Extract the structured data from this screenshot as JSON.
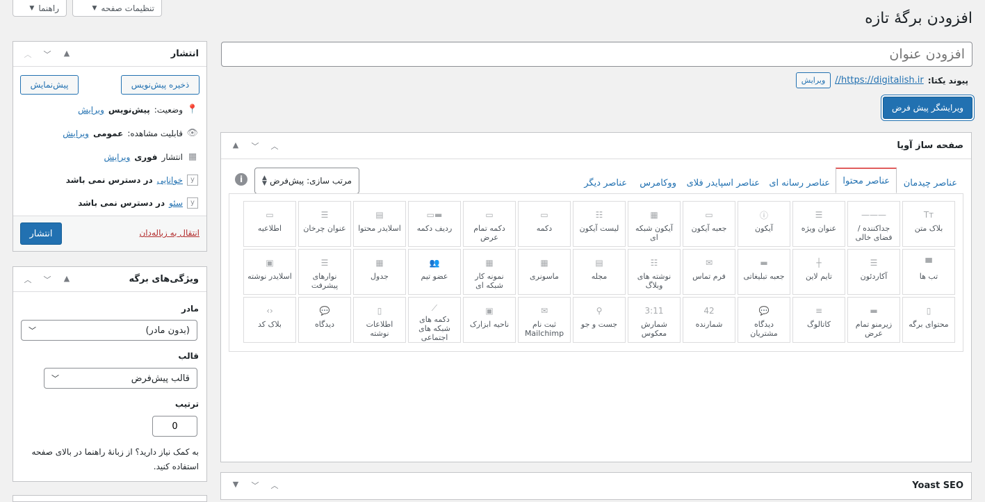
{
  "top_buttons": {
    "screen_options": "تنظیمات صفحه",
    "help": "راهنما"
  },
  "page_title": "افزودن برگهٔ تازه",
  "title_input": {
    "placeholder": "افزودن عنوان",
    "value": ""
  },
  "permalink": {
    "label": "پیوند یکتا:",
    "url": "https://digitalish.ir//",
    "edit": "ویرایش"
  },
  "default_editor_button": "ویرایشگر پیش فرض",
  "builder": {
    "title": "صفحه ساز آویا",
    "tabs": [
      "عناصر چیدمان",
      "عناصر محتوا",
      "عناصر رسانه ای",
      "عناصر اسپایدر فلای",
      "ووکامرس",
      "عناصر دیگر"
    ],
    "active_tab": "عناصر محتوا",
    "sort_label": "مرتب سازی: پیش‌فرض",
    "elements": [
      {
        "label": "بلاک متن",
        "icon": "text-block-icon"
      },
      {
        "label": "جداکننده / فضای خالی",
        "icon": "separator-icon"
      },
      {
        "label": "عنوان ویژه",
        "icon": "special-heading-icon"
      },
      {
        "label": "آیکون",
        "icon": "info-circle-icon"
      },
      {
        "label": "جعبه آیکون",
        "icon": "icon-box-icon"
      },
      {
        "label": "آیکون شبکه ای",
        "icon": "icon-grid-icon"
      },
      {
        "label": "لیست آیکون",
        "icon": "icon-list-icon"
      },
      {
        "label": "دکمه",
        "icon": "button-icon"
      },
      {
        "label": "دکمه تمام عرض",
        "icon": "fullwidth-button-icon"
      },
      {
        "label": "ردیف دکمه",
        "icon": "button-row-icon"
      },
      {
        "label": "اسلایدر محتوا",
        "icon": "content-slider-icon"
      },
      {
        "label": "عنوان چرخان",
        "icon": "rotating-heading-icon"
      },
      {
        "label": "اطلاعیه",
        "icon": "notification-icon"
      },
      {
        "label": "تب ها",
        "icon": "tabs-icon"
      },
      {
        "label": "آکاردئون",
        "icon": "accordion-icon"
      },
      {
        "label": "تایم لاین",
        "icon": "timeline-icon"
      },
      {
        "label": "جعبه تبلیغاتی",
        "icon": "promo-box-icon"
      },
      {
        "label": "فرم تماس",
        "icon": "envelope-icon"
      },
      {
        "label": "نوشته های وبلاگ",
        "icon": "blog-posts-icon"
      },
      {
        "label": "مجله",
        "icon": "magazine-icon"
      },
      {
        "label": "ماسونری",
        "icon": "masonry-icon"
      },
      {
        "label": "نمونه کار شبکه ای",
        "icon": "portfolio-grid-icon"
      },
      {
        "label": "عضو تیم",
        "icon": "team-member-icon"
      },
      {
        "label": "جدول",
        "icon": "table-icon"
      },
      {
        "label": "نوارهای پیشرفت",
        "icon": "progress-bars-icon"
      },
      {
        "label": "اسلایدر نوشته",
        "icon": "post-slider-icon"
      },
      {
        "label": "محتوای برگه",
        "icon": "page-content-icon"
      },
      {
        "label": "زیرمنو تمام عرض",
        "icon": "fullwidth-submenu-icon"
      },
      {
        "label": "کاتالوگ",
        "icon": "catalogue-icon"
      },
      {
        "label": "دیدگاه مشتریان",
        "icon": "testimonials-icon"
      },
      {
        "label": "شمارنده",
        "icon": "counter-icon"
      },
      {
        "label": "شمارش معکوس",
        "icon": "countdown-icon"
      },
      {
        "label": "جست و جو",
        "icon": "search-icon"
      },
      {
        "label": "ثبت نام Mailchimp",
        "icon": "mailchimp-icon"
      },
      {
        "label": "ناحیه ابزارک",
        "icon": "widget-area-icon"
      },
      {
        "label": "دکمه های شبکه های اجتماعی",
        "icon": "social-buttons-icon"
      },
      {
        "label": "اطلاعات نوشته",
        "icon": "post-info-icon"
      },
      {
        "label": "دیدگاه",
        "icon": "comments-icon"
      },
      {
        "label": "بلاک کد",
        "icon": "code-block-icon"
      }
    ]
  },
  "yoast": {
    "title": "Yoast SEO"
  },
  "publish": {
    "title": "انتشار",
    "save_draft": "ذخیره پیش‌نویس",
    "preview": "پیش‌نمایش",
    "status_label": "وضعیت:",
    "status_value": "پیش‌نویس",
    "visibility_label": "قابلیت مشاهده:",
    "visibility_value": "عمومی",
    "publish_label": "انتشار",
    "publish_value": "فوری",
    "edit": "ویرایش",
    "readability_link": "خوانایی",
    "readability_value": "در دسترس نمی باشد",
    "seo_link": "سئو",
    "seo_value": "در دسترس نمی باشد",
    "trash": "انتقال به زباله‌دان",
    "publish_button": "انتشار"
  },
  "attributes": {
    "title": "ویژگی‌های برگه",
    "parent_label": "مادر",
    "parent_value": "(بدون مادر)",
    "template_label": "قالب",
    "template_value": "قالب پیش‌فرض",
    "order_label": "ترتیب",
    "order_value": "0",
    "help_text": "به کمک نیاز دارید؟ از زبانهٔ راهنما در بالای صفحه استفاده کنید."
  }
}
